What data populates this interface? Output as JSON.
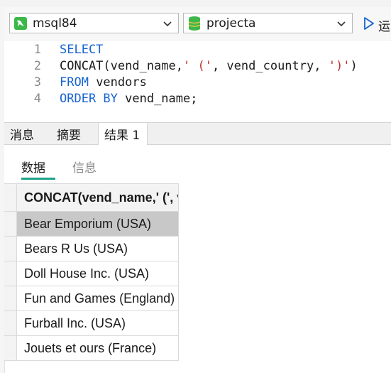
{
  "toolbar": {
    "connection": {
      "value": "msql84",
      "icon": "dolphin-icon"
    },
    "database": {
      "value": "projecta",
      "icon": "database-icon"
    },
    "run": {
      "label": "运",
      "icon": "play-icon"
    }
  },
  "editor": {
    "line_numbers": [
      "1",
      "2",
      "3",
      "4"
    ],
    "lines": [
      [
        {
          "t": "SELECT",
          "k": "kw"
        }
      ],
      [
        {
          "t": "CONCAT(vend_name,",
          "k": ""
        },
        {
          "t": "' ('",
          "k": "str"
        },
        {
          "t": ", vend_country, ",
          "k": ""
        },
        {
          "t": "')'",
          "k": "str"
        },
        {
          "t": ")",
          "k": ""
        }
      ],
      [
        {
          "t": "FROM",
          "k": "kw"
        },
        {
          "t": " vendors",
          "k": ""
        }
      ],
      [
        {
          "t": "ORDER BY",
          "k": "kw"
        },
        {
          "t": " vend_name;",
          "k": ""
        }
      ]
    ]
  },
  "tabs": [
    "消息",
    "摘要",
    "结果 1"
  ],
  "subtabs": [
    "数据",
    "信息"
  ],
  "grid": {
    "header": "CONCAT(vend_name,' (', vend_country, ')')",
    "rows": [
      "Bear Emporium (USA)",
      "Bears R Us (USA)",
      "Doll House Inc. (USA)",
      "Fun and Games (England)",
      "Furball Inc. (USA)",
      "Jouets et ours (France)"
    ]
  },
  "colors": {
    "keyword": "#1764d0",
    "string": "#c0342d",
    "accent": "#1ea38a",
    "selected_row": "#c8c8c8"
  }
}
